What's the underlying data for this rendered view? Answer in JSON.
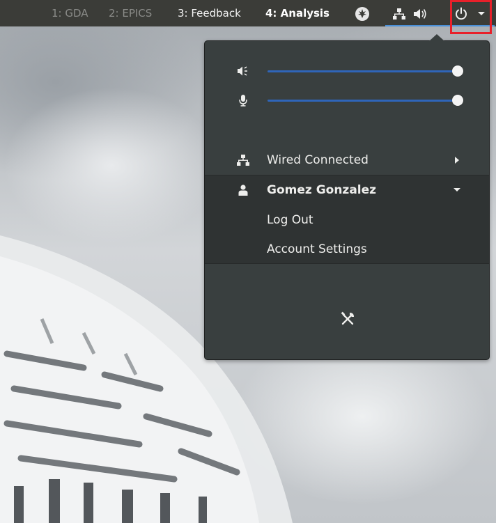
{
  "topbar": {
    "workspaces": [
      {
        "label": "1: GDA",
        "active": false
      },
      {
        "label": "2: EPICS",
        "active": false
      },
      {
        "label": "3: Feedback",
        "active": false
      },
      {
        "label": "4: Analysis",
        "active": true
      }
    ],
    "icons": {
      "app_indicator": "leaf-icon",
      "network": "network-icon",
      "volume": "volume-icon",
      "power": "power-icon",
      "menu_arrow": "chevron-down-icon"
    }
  },
  "menu": {
    "volume": {
      "icon": "speaker-icon",
      "level": 1.0
    },
    "microphone": {
      "icon": "microphone-icon",
      "level": 1.0
    },
    "network": {
      "icon": "network-icon",
      "label": "Wired Connected",
      "arrow": "chevron-right-icon"
    },
    "user": {
      "icon": "person-icon",
      "name": "Gomez Gonzalez",
      "arrow": "chevron-down-icon"
    },
    "logout": {
      "label": "Log Out"
    },
    "account_settings": {
      "label": "Account Settings"
    },
    "settings_button": {
      "icon": "settings-tools-icon"
    }
  },
  "colors": {
    "topbar_bg": "#3b3c38",
    "menu_bg": "#393f3f",
    "user_section_bg": "#2f3333",
    "accent": "#2f65b9",
    "highlight": "#e8202a"
  }
}
